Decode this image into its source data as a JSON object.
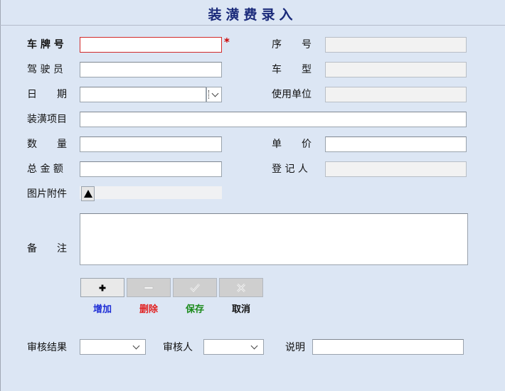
{
  "title": "装潢费录入",
  "colors": {
    "accent": "#1a2a7a",
    "required": "#d12a2a",
    "add": "#1f2fd6",
    "delete": "#e12020",
    "save": "#1a8a1a",
    "cancel": "#111111"
  },
  "fields": {
    "plate_label": "车 牌 号",
    "plate_value": "",
    "required_mark": "*",
    "serial_label": "序　　号",
    "serial_value": "",
    "driver_label": "驾 驶 员",
    "driver_value": "",
    "car_type_label": "车　　型",
    "car_type_value": "",
    "date_label": "日　　期",
    "date_value": "",
    "unit_label": "使用单位",
    "unit_value": "",
    "item_label": "装潢项目",
    "item_value": "",
    "quantity_label": "数　　量",
    "quantity_value": "",
    "price_label": "单　　价",
    "price_value": "",
    "total_label": "总 金 额",
    "total_value": "",
    "recorder_label": "登 记 人",
    "recorder_value": "",
    "attachment_label": "图片附件",
    "remark_label": "备　　注",
    "remark_value": ""
  },
  "toolbar": {
    "add_icon": "plus-icon",
    "add_label": "增加",
    "delete_icon": "minus-icon",
    "delete_label": "删除",
    "save_icon": "check-icon",
    "save_label": "保存",
    "cancel_icon": "x-icon",
    "cancel_label": "取消"
  },
  "review": {
    "result_label": "审核结果",
    "result_value": "",
    "reviewer_label": "审核人",
    "reviewer_value": "",
    "note_label": "说明",
    "note_value": ""
  }
}
